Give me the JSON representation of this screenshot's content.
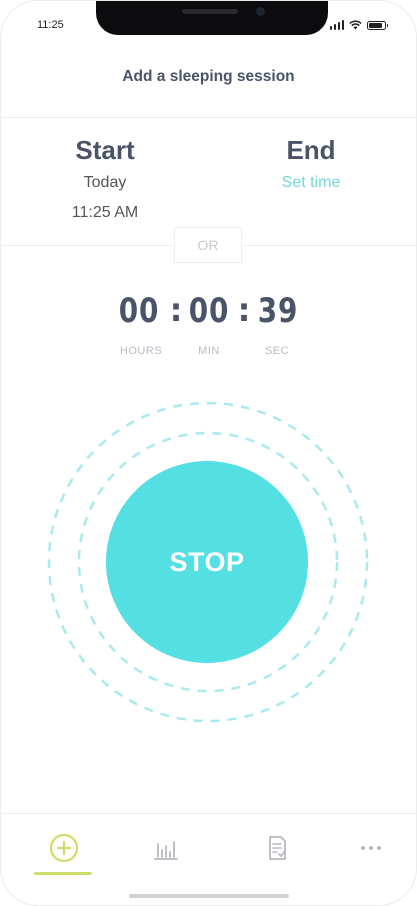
{
  "status_bar": {
    "time": "11:25"
  },
  "header": {
    "title": "Add a sleeping session"
  },
  "start": {
    "label": "Start",
    "day": "Today",
    "time": "11:25 AM"
  },
  "end": {
    "label": "End",
    "set_time": "Set time"
  },
  "separator": {
    "or": "OR"
  },
  "timer": {
    "hours": "00",
    "minutes": "00",
    "seconds": "39",
    "colon": ":",
    "units": {
      "hours": "HOURS",
      "minutes": "MIN",
      "seconds": "SEC"
    }
  },
  "action": {
    "stop_label": "STOP"
  },
  "tabs": [
    {
      "icon": "plus-circle-icon",
      "active": true
    },
    {
      "icon": "bar-chart-icon",
      "active": false
    },
    {
      "icon": "report-icon",
      "active": false
    },
    {
      "icon": "more-icon",
      "active": false
    }
  ],
  "colors": {
    "accent": "#54dfe2",
    "link": "#6fd6dc",
    "active_tab": "#c8e06a",
    "text_primary": "#4a5368"
  }
}
